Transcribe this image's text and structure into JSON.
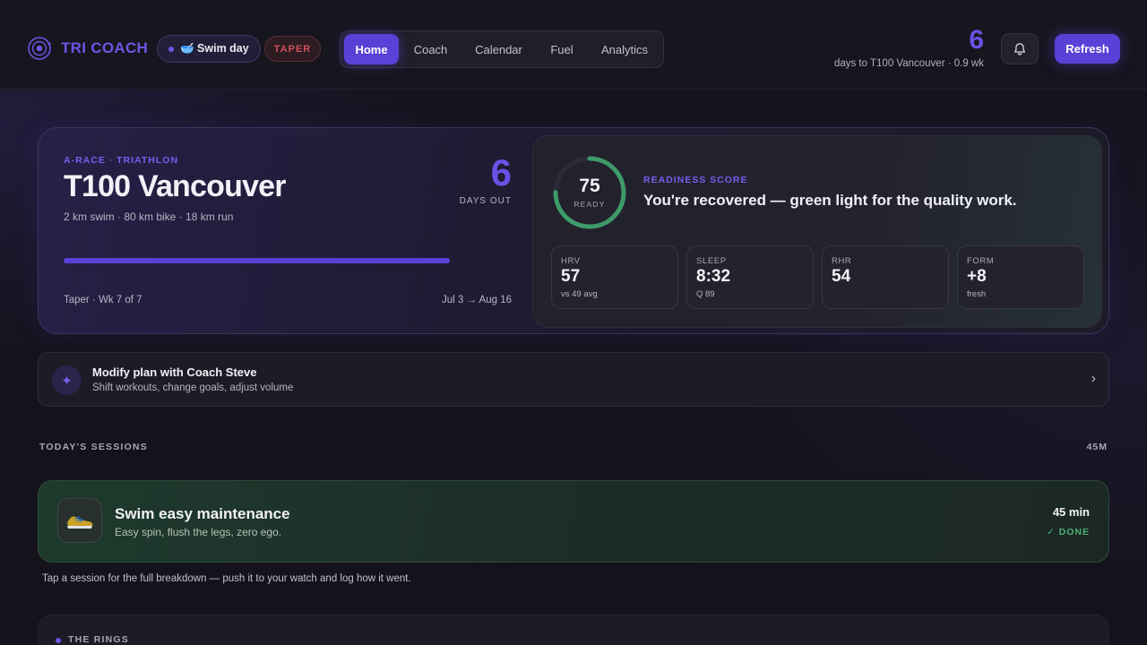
{
  "app": {
    "name": "TRI COACH"
  },
  "header": {
    "day_pill": "🥣 Swim day",
    "phase_badge": "TAPER",
    "nav": [
      {
        "label": "Home",
        "active": true
      },
      {
        "label": "Coach",
        "active": false
      },
      {
        "label": "Calendar",
        "active": false
      },
      {
        "label": "Fuel",
        "active": false
      },
      {
        "label": "Analytics",
        "active": false
      }
    ],
    "countdown_days": "6",
    "countdown_text": "days to T100 Vancouver · 0.9 wk",
    "refresh_label": "Refresh"
  },
  "race": {
    "kicker": "A-RACE · TRIATHLON",
    "title": "T100 Vancouver",
    "distances": "2 km swim · 80 km bike · 18 km run",
    "days_out": "6",
    "days_out_label": "DAYS OUT",
    "progress": 1.0,
    "phase": "Taper · Wk 7 of 7",
    "date_range": "Jul 3 → Aug 16"
  },
  "readiness": {
    "score": "75",
    "score_label": "READY",
    "score_fraction": 0.75,
    "kicker": "READINESS SCORE",
    "message": "You're recovered — green light for the quality work.",
    "ring_color": "#3f9a6a",
    "metrics": [
      {
        "key": "HRV",
        "value": "57",
        "sub": "vs 49 avg"
      },
      {
        "key": "SLEEP",
        "value": "8:32",
        "sub": "Q 89"
      },
      {
        "key": "RHR",
        "value": "54",
        "sub": ""
      },
      {
        "key": "FORM",
        "value": "+8",
        "sub": "fresh"
      }
    ]
  },
  "coach_row": {
    "icon": "sparkle-icon",
    "title": "Modify plan with Coach Steve",
    "subtitle": "Shift workouts, change goals, adjust volume"
  },
  "sessions": {
    "heading": "TODAY'S SESSIONS",
    "total": "45M",
    "items": [
      {
        "title": "Swim easy maintenance",
        "subtitle": "Easy spin, flush the legs, zero ego.",
        "duration": "45 min",
        "status": "✓ DONE",
        "icon": "shoe-icon"
      }
    ],
    "hint": "Tap a session for the full breakdown — push it to your watch and log how it went."
  },
  "rings": {
    "heading": "THE RINGS"
  },
  "colors": {
    "accent": "#5a40d6",
    "danger": "#d0505a",
    "success": "#4caf74"
  }
}
